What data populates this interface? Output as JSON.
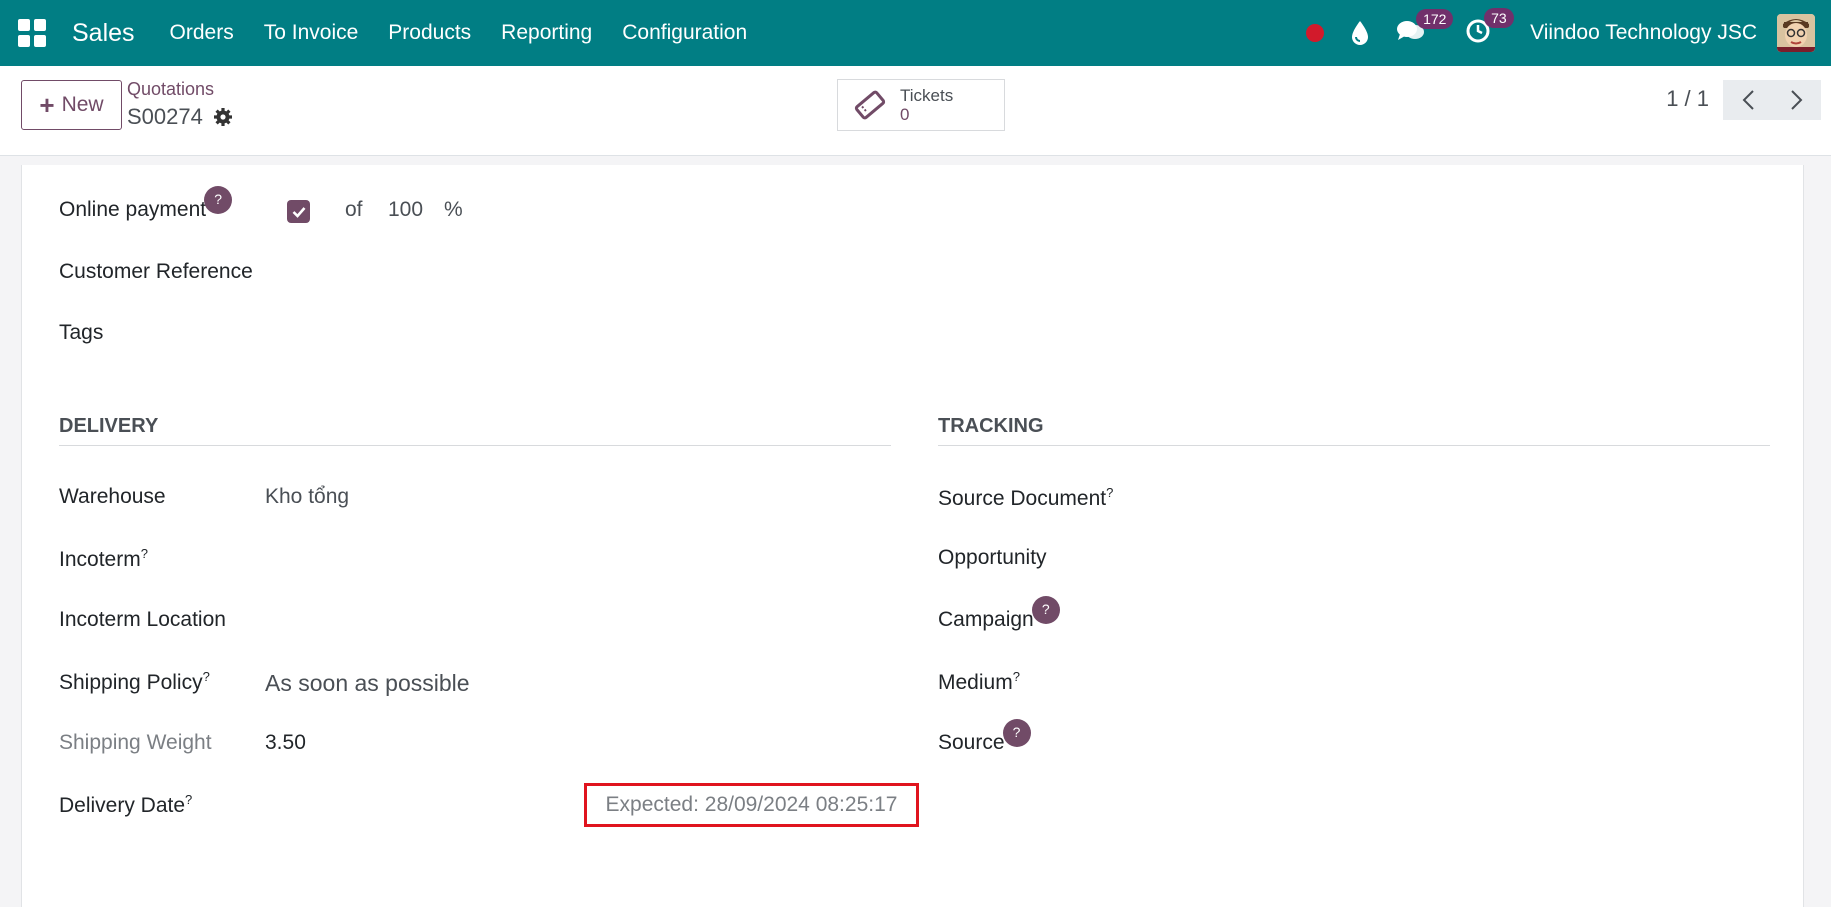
{
  "navbar": {
    "app_name": "Sales",
    "menu": [
      "Orders",
      "To Invoice",
      "Products",
      "Reporting",
      "Configuration"
    ],
    "messages_count": "172",
    "activities_count": "73",
    "company": "Viindoo Technology JSC",
    "accent": "#017e84"
  },
  "control": {
    "new_label": "New",
    "breadcrumb": "Quotations",
    "record": "S00274",
    "smart_button": {
      "label": "Tickets",
      "value": "0"
    },
    "pager": "1 / 1"
  },
  "form": {
    "online_payment": {
      "label": "Online payment",
      "help": "?",
      "checked": true,
      "of": "of",
      "percent": "100",
      "unit": "%"
    },
    "customer_reference": "Customer Reference",
    "tags": "Tags",
    "delivery": {
      "title": "DELIVERY",
      "warehouse_label": "Warehouse",
      "warehouse_value": "Kho tổng",
      "incoterm_label": "Incoterm",
      "incoterm_location_label": "Incoterm Location",
      "shipping_policy_label": "Shipping Policy",
      "shipping_policy_value": "As soon as possible",
      "shipping_weight_label": "Shipping Weight",
      "shipping_weight_value": "3.50",
      "delivery_date_label": "Delivery Date",
      "expected": "Expected: 28/09/2024 08:25:17"
    },
    "tracking": {
      "title": "TRACKING",
      "source_document": "Source Document",
      "opportunity": "Opportunity",
      "campaign": "Campaign",
      "medium": "Medium",
      "source": "Source"
    },
    "help_mark": "?"
  }
}
